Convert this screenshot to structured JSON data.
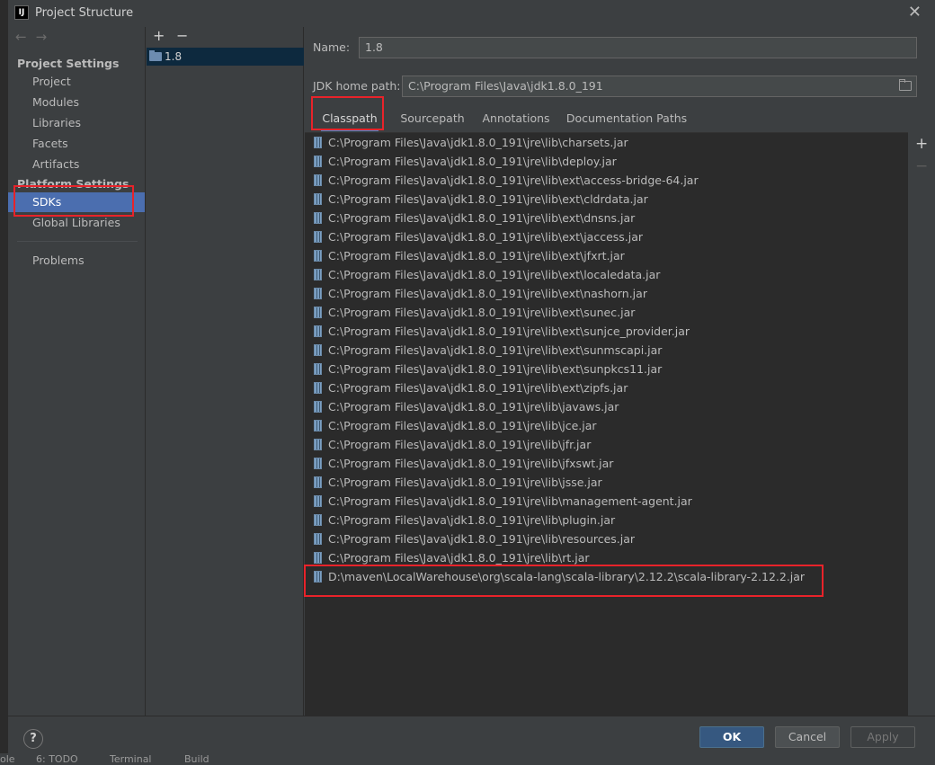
{
  "window": {
    "title": "Project Structure",
    "logo": "IJ",
    "close_label": "✕"
  },
  "background_strip": {
    "items": [
      "ole",
      "6: TODO",
      "Terminal",
      "Build"
    ]
  },
  "nav": {
    "back_icon": "←",
    "forward_icon": "→",
    "project_settings_header": "Project Settings",
    "project_items": [
      "Project",
      "Modules",
      "Libraries",
      "Facets",
      "Artifacts"
    ],
    "platform_settings_header": "Platform Settings",
    "platform_items": [
      "SDKs",
      "Global Libraries"
    ],
    "selected": "SDKs",
    "problems": "Problems"
  },
  "sdk_list": {
    "add_label": "+",
    "remove_label": "−",
    "items": [
      "1.8"
    ]
  },
  "detail": {
    "name_label": "Name:",
    "name_value": "1.8",
    "jdk_home_label": "JDK home path:",
    "jdk_home_value": "C:\\Program Files\\Java\\jdk1.8.0_191",
    "tabs": [
      "Classpath",
      "Sourcepath",
      "Annotations",
      "Documentation Paths"
    ],
    "active_tab": "Classpath",
    "classpath": [
      "C:\\Program Files\\Java\\jdk1.8.0_191\\jre\\lib\\charsets.jar",
      "C:\\Program Files\\Java\\jdk1.8.0_191\\jre\\lib\\deploy.jar",
      "C:\\Program Files\\Java\\jdk1.8.0_191\\jre\\lib\\ext\\access-bridge-64.jar",
      "C:\\Program Files\\Java\\jdk1.8.0_191\\jre\\lib\\ext\\cldrdata.jar",
      "C:\\Program Files\\Java\\jdk1.8.0_191\\jre\\lib\\ext\\dnsns.jar",
      "C:\\Program Files\\Java\\jdk1.8.0_191\\jre\\lib\\ext\\jaccess.jar",
      "C:\\Program Files\\Java\\jdk1.8.0_191\\jre\\lib\\ext\\jfxrt.jar",
      "C:\\Program Files\\Java\\jdk1.8.0_191\\jre\\lib\\ext\\localedata.jar",
      "C:\\Program Files\\Java\\jdk1.8.0_191\\jre\\lib\\ext\\nashorn.jar",
      "C:\\Program Files\\Java\\jdk1.8.0_191\\jre\\lib\\ext\\sunec.jar",
      "C:\\Program Files\\Java\\jdk1.8.0_191\\jre\\lib\\ext\\sunjce_provider.jar",
      "C:\\Program Files\\Java\\jdk1.8.0_191\\jre\\lib\\ext\\sunmscapi.jar",
      "C:\\Program Files\\Java\\jdk1.8.0_191\\jre\\lib\\ext\\sunpkcs11.jar",
      "C:\\Program Files\\Java\\jdk1.8.0_191\\jre\\lib\\ext\\zipfs.jar",
      "C:\\Program Files\\Java\\jdk1.8.0_191\\jre\\lib\\javaws.jar",
      "C:\\Program Files\\Java\\jdk1.8.0_191\\jre\\lib\\jce.jar",
      "C:\\Program Files\\Java\\jdk1.8.0_191\\jre\\lib\\jfr.jar",
      "C:\\Program Files\\Java\\jdk1.8.0_191\\jre\\lib\\jfxswt.jar",
      "C:\\Program Files\\Java\\jdk1.8.0_191\\jre\\lib\\jsse.jar",
      "C:\\Program Files\\Java\\jdk1.8.0_191\\jre\\lib\\management-agent.jar",
      "C:\\Program Files\\Java\\jdk1.8.0_191\\jre\\lib\\plugin.jar",
      "C:\\Program Files\\Java\\jdk1.8.0_191\\jre\\lib\\resources.jar",
      "C:\\Program Files\\Java\\jdk1.8.0_191\\jre\\lib\\rt.jar",
      "D:\\maven\\LocalWarehouse\\org\\scala-lang\\scala-library\\2.12.2\\scala-library-2.12.2.jar"
    ],
    "side_add": "+",
    "side_remove": "−"
  },
  "footer": {
    "help_label": "?",
    "ok_label": "OK",
    "cancel_label": "Cancel",
    "apply_label": "Apply"
  },
  "colors": {
    "accent": "#4b6eaf",
    "highlight_box": "#e8232a",
    "primary_button": "#365880"
  }
}
